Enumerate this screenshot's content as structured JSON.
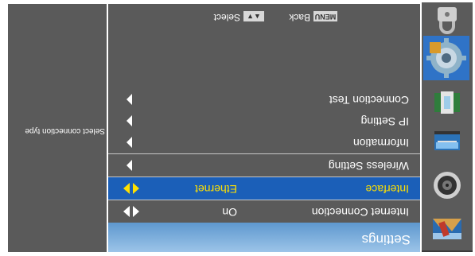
{
  "menu": {
    "title": "Settings",
    "rows": [
      {
        "label": "Internet Connection",
        "value": "On",
        "control": "left-right"
      },
      {
        "label": "Interface",
        "value": "Ethernet",
        "control": "left-right",
        "highlighted": true
      },
      {
        "label": "Wireless Setting",
        "value": "",
        "control": "right"
      },
      {
        "label": "Information",
        "value": "",
        "control": "right"
      },
      {
        "label": "IP Setting",
        "value": "",
        "control": "right"
      },
      {
        "label": "Connection Test",
        "value": "",
        "control": "right"
      }
    ]
  },
  "footer": {
    "select_key": "▲▼",
    "select_label": "Select",
    "back_key": "MENU",
    "back_label": "Back"
  },
  "help": {
    "text": "Select connection type"
  },
  "icons": [
    "picture-icon",
    "sound-icon",
    "channel-icon",
    "usb-icon",
    "network-settings-icon",
    "lock-icon"
  ],
  "colors": {
    "panel": "#5a5a5a",
    "header": "#5e98cf",
    "highlight": "#1b5fb8",
    "highlight_text": "#ffe000"
  }
}
